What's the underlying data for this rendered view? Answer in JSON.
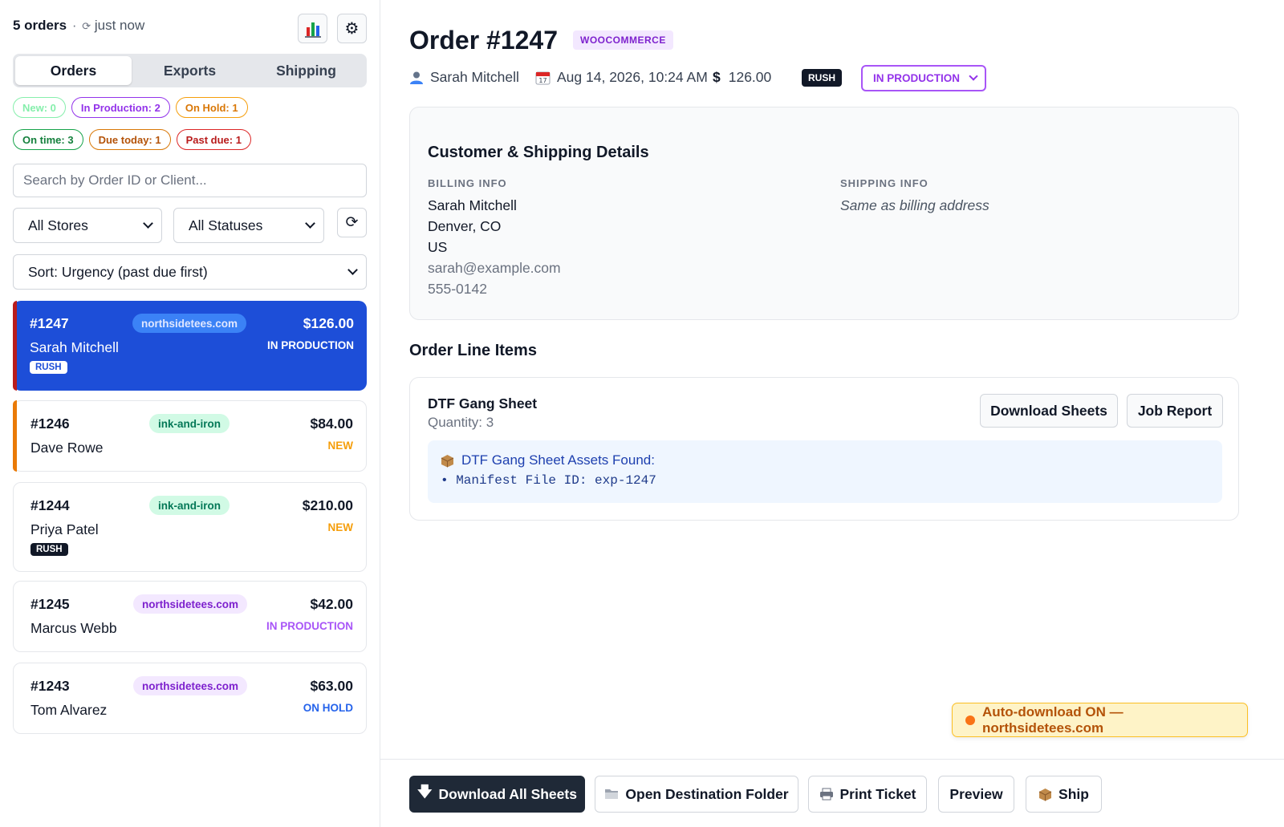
{
  "sidebar": {
    "order_count": "5 orders",
    "separator": "·",
    "sync_icon": "⟳",
    "updated": "just now",
    "stats_icon": "bar-chart-icon",
    "settings_icon": "gear-icon",
    "tabs": [
      {
        "label": "Orders",
        "active": true
      },
      {
        "label": "Exports",
        "active": false
      },
      {
        "label": "Shipping",
        "active": false
      }
    ],
    "status_chips": [
      {
        "label": "New: 0",
        "color": "#86efac"
      },
      {
        "label": "In Production: 2",
        "color": "#9333ea"
      },
      {
        "label": "On Hold: 1",
        "color": "#f59e0b"
      }
    ],
    "time_chips": [
      {
        "label": "On time: 3",
        "color": "#16a34a"
      },
      {
        "label": "Due today: 1",
        "color": "#d97706"
      },
      {
        "label": "Past due: 1",
        "color": "#dc2626"
      }
    ],
    "search_placeholder": "Search by Order ID or Client...",
    "store_filter": "All Stores",
    "status_filter": "All Statuses",
    "refresh_icon": "⟳",
    "sort": "Sort: Urgency (past due first)",
    "orders": [
      {
        "id": "#1247",
        "client": "Sarah Mitchell",
        "store": "northsidetees.com",
        "amount": "$126.00",
        "status": "IN PRODUCTION",
        "rush": "RUSH"
      },
      {
        "id": "#1246",
        "client": "Dave Rowe",
        "store": "ink-and-iron",
        "amount": "$84.00",
        "status": "NEW"
      },
      {
        "id": "#1244",
        "client": "Priya Patel",
        "store": "ink-and-iron",
        "amount": "$210.00",
        "status": "NEW",
        "rush": "RUSH"
      },
      {
        "id": "#1245",
        "client": "Marcus Webb",
        "store": "northsidetees.com",
        "amount": "$42.00",
        "status": "IN PRODUCTION"
      },
      {
        "id": "#1243",
        "client": "Tom Alvarez",
        "store": "northsidetees.com",
        "amount": "$63.00",
        "status": "ON HOLD"
      }
    ]
  },
  "order": {
    "title": "Order #1247",
    "platform": "WOOCOMMERCE",
    "customer": "Sarah Mitchell",
    "date": "Aug 14, 2026, 10:24 AM",
    "currency_symbol": "$",
    "total": "126.00",
    "rush": "RUSH",
    "status": "IN PRODUCTION"
  },
  "details": {
    "title": "Customer & Shipping Details",
    "billing_caption": "BILLING INFO",
    "billing": [
      "Sarah Mitchell",
      "Denver, CO",
      "US"
    ],
    "email": "sarah@example.com",
    "phone": "555-0142",
    "shipping_caption": "SHIPPING INFO",
    "shipping": "Same as billing address"
  },
  "line_items": {
    "title": "Order Line Items",
    "item_name": "DTF Gang Sheet",
    "quantity": "Quantity: 3",
    "download_label": "Download Sheets",
    "report_label": "Job Report",
    "assets_title": "DTF Gang Sheet Assets Found:",
    "assets_line": "• Manifest File ID: exp-1247"
  },
  "toast": "Auto-download ON — northsidetees.com",
  "footer": {
    "download_all": "Download All Sheets",
    "open_folder": "Open Destination Folder",
    "print_ticket": "Print Ticket",
    "preview": "Preview",
    "ship": "Ship"
  }
}
